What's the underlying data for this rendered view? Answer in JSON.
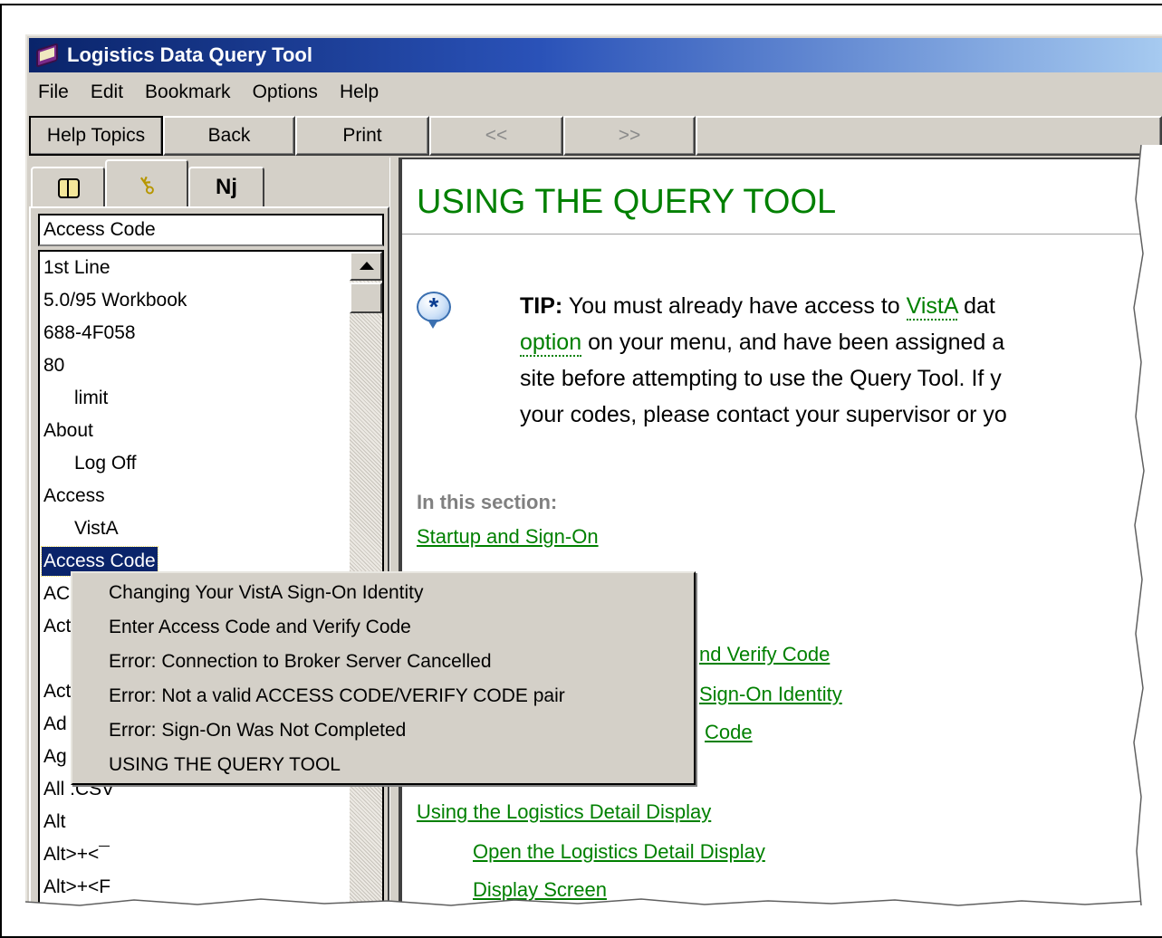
{
  "window": {
    "title": "Logistics Data Query Tool"
  },
  "menubar": {
    "items": [
      "File",
      "Edit",
      "Bookmark",
      "Options",
      "Help"
    ]
  },
  "toolbar": {
    "help_topics": "Help Topics",
    "back": "Back",
    "print": "Print",
    "prev": "<<",
    "next": ">>"
  },
  "left_pane": {
    "tabs": [
      {
        "name": "contents",
        "icon": "contents-book-icon"
      },
      {
        "name": "index",
        "icon": "key-icon"
      },
      {
        "name": "find",
        "icon": "binoculars-icon"
      }
    ],
    "keyword_input_value": "Access Code",
    "keywords": [
      {
        "label": "1st Line",
        "indent": false
      },
      {
        "label": "5.0/95 Workbook",
        "indent": false
      },
      {
        "label": "688-4F058",
        "indent": false
      },
      {
        "label": "80",
        "indent": false
      },
      {
        "label": "limit",
        "indent": true
      },
      {
        "label": "About",
        "indent": false
      },
      {
        "label": "Log Off",
        "indent": true
      },
      {
        "label": "Access",
        "indent": false
      },
      {
        "label": "VistA",
        "indent": true
      },
      {
        "label": "Access Code",
        "indent": false,
        "selected": true
      },
      {
        "label": "AC",
        "indent": false
      },
      {
        "label": "Act",
        "indent": false
      },
      {
        "label": "",
        "indent": false
      },
      {
        "label": "Act",
        "indent": false
      },
      {
        "label": "Ad",
        "indent": false
      },
      {
        "label": "Ag",
        "indent": false
      },
      {
        "label": "All .CSV",
        "indent": false
      },
      {
        "label": "Alt",
        "indent": false
      },
      {
        "label": "Alt>+<¯",
        "indent": false
      },
      {
        "label": "Alt>+<F",
        "indent": false
      }
    ]
  },
  "content": {
    "title": "USING THE QUERY TOOL",
    "tip_icon": "tip-balloon-icon",
    "tip_label": "TIP:",
    "tip_line1_a": " You must already have access to ",
    "tip_line1_link": "VistA",
    "tip_line1_b": " dat",
    "tip_line2_link": "option",
    "tip_line2_b": " on your menu, and have been assigned a",
    "tip_line3": "site before attempting to use the Query Tool.  If y",
    "tip_line4": "your codes, please contact your supervisor or yo",
    "section_heading": "In this section:",
    "links": [
      {
        "label": "Startup and Sign-On"
      },
      {
        "label": "nd Verify Code"
      },
      {
        "label": "Sign-On Identity"
      },
      {
        "label": "Code"
      },
      {
        "label": "Using the Logistics Detail Display"
      },
      {
        "label": "Open the Logistics Detail Display"
      },
      {
        "label": "Display Screen"
      }
    ]
  },
  "popup": {
    "items": [
      "Changing Your VistA Sign-On Identity",
      "Enter Access Code and Verify Code",
      "Error: Connection to Broker Server Cancelled",
      "Error: Not a valid ACCESS CODE/VERIFY CODE pair",
      "Error: Sign-On Was Not Completed",
      "USING THE QUERY TOOL"
    ]
  },
  "colors": {
    "link_green": "#008000",
    "selection_navy": "#0a246a",
    "window_gray": "#d4d0c8"
  }
}
